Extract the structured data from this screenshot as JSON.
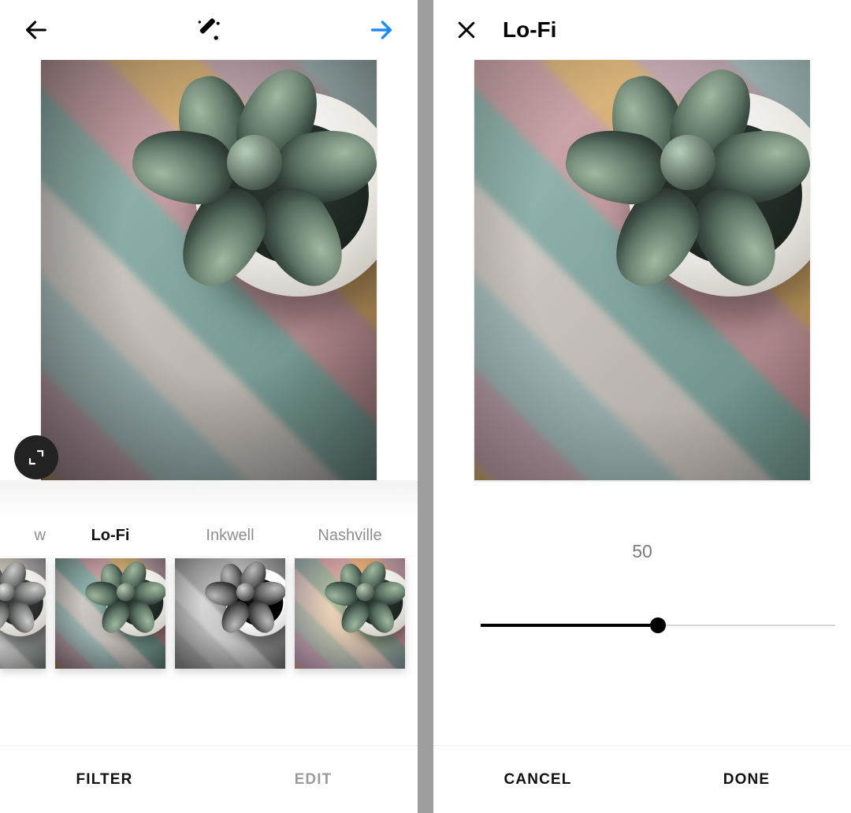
{
  "left": {
    "header": {
      "back_icon": "arrow-left",
      "wand_icon": "magic-wand",
      "next_icon": "arrow-right"
    },
    "expand_icon": "expand",
    "filters": [
      {
        "id": "willow",
        "label": "w",
        "label_full": "Willow",
        "partial": true,
        "active": false,
        "variant": "flt-willow"
      },
      {
        "id": "lofi",
        "label": "Lo-Fi",
        "partial": false,
        "active": true,
        "variant": ""
      },
      {
        "id": "inkwell",
        "label": "Inkwell",
        "partial": false,
        "active": false,
        "variant": "flt-inkwell"
      },
      {
        "id": "nashville",
        "label": "Nashville",
        "partial": false,
        "active": false,
        "variant": "flt-nash"
      }
    ],
    "tabs": {
      "filter": "FILTER",
      "edit": "EDIT",
      "active": "filter"
    }
  },
  "right": {
    "header": {
      "close_icon": "close",
      "title": "Lo-Fi"
    },
    "slider": {
      "value": 50,
      "min": 0,
      "max": 100
    },
    "actions": {
      "cancel": "CANCEL",
      "done": "DONE"
    }
  }
}
